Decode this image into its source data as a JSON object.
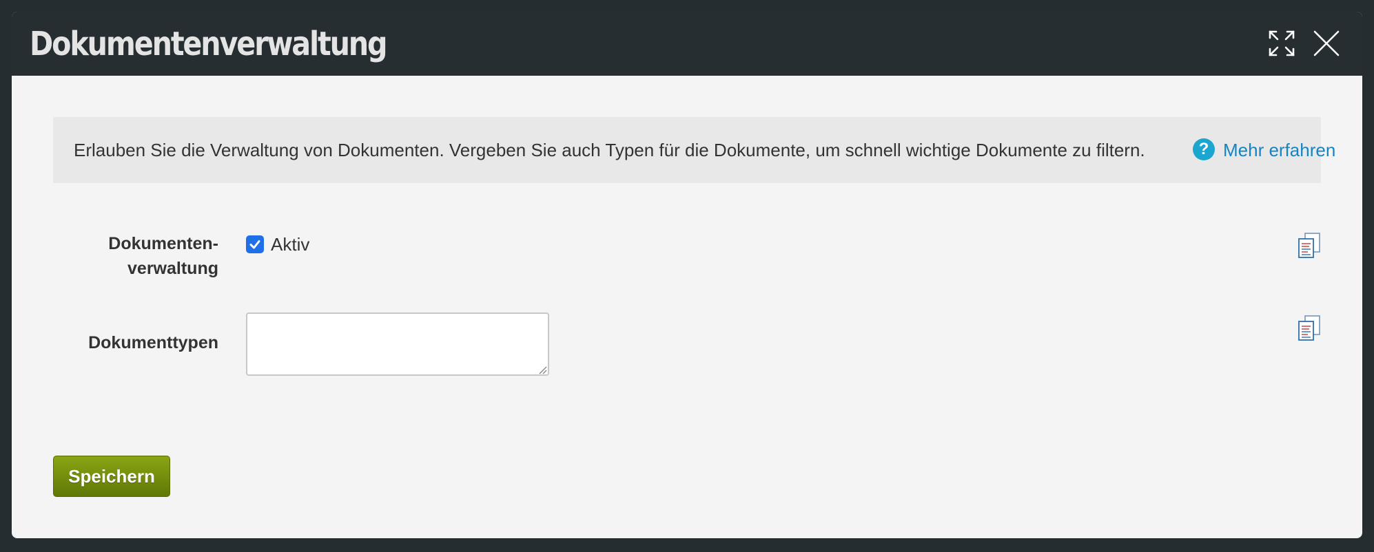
{
  "dialog": {
    "title": "Dokumentenverwaltung",
    "maximize_icon": "expand-arrows-icon",
    "close_icon": "close-x-icon"
  },
  "info": {
    "text": "Erlauben Sie die Verwaltung von Dokumenten. Vergeben Sie auch Typen für die Dokumente, um schnell wichtige Dokumente zu filtern.",
    "help_icon": "?",
    "link_label": "Mehr erfahren"
  },
  "fields": {
    "document_management": {
      "label_line1": "Dokumenten-",
      "label_line2": "verwaltung",
      "checkbox_label": "Aktiv",
      "checked": true
    },
    "document_types": {
      "label": "Dokumenttypen",
      "value": "",
      "placeholder": ""
    }
  },
  "actions": {
    "save_label": "Speichern"
  },
  "colors": {
    "titlebar": "#262e31",
    "accent_link": "#1585c1",
    "help_icon": "#1ba6cf",
    "checkbox": "#1f6fe8",
    "save_button": "#7a950f"
  }
}
